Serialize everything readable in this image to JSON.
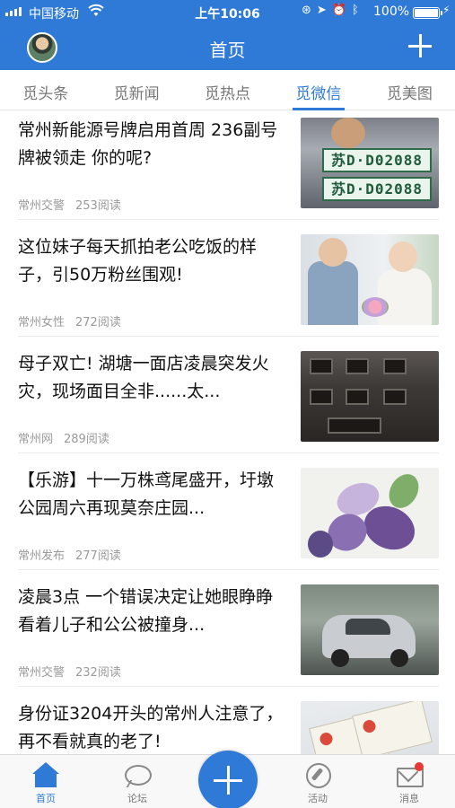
{
  "colors": {
    "brand": "#2f7ad6",
    "badge": "#e53935"
  },
  "status_bar": {
    "carrier": "中国移动",
    "time": "上午10:06",
    "battery": "100%"
  },
  "header": {
    "title": "首页",
    "avatar_icon": "user-avatar",
    "add_icon": "plus-icon"
  },
  "tabs": [
    {
      "label": "觅头条",
      "active": false
    },
    {
      "label": "觅新闻",
      "active": false
    },
    {
      "label": "觅热点",
      "active": false
    },
    {
      "label": "觅微信",
      "active": true
    },
    {
      "label": "觅美图",
      "active": false
    }
  ],
  "articles": [
    {
      "title": "常州新能源号牌启用首周 236副号牌被领走 你的呢?",
      "source": "常州交警",
      "reads": "253阅读",
      "plate_text": "苏D·D02088"
    },
    {
      "title": "这位妹子每天抓拍老公吃饭的样子，引50万粉丝围观!",
      "source": "常州女性",
      "reads": "272阅读"
    },
    {
      "title": "母子双亡! 湖塘一面店凌晨突发火灾，现场面目全非......太...",
      "source": "常州网",
      "reads": "289阅读"
    },
    {
      "title": "【乐游】十一万株鸢尾盛开，圩墩公园周六再现莫奈庄园...",
      "source": "常州发布",
      "reads": "277阅读"
    },
    {
      "title": "凌晨3点 一个错误决定让她眼睁睁看着儿子和公公被撞身...",
      "source": "常州交警",
      "reads": "232阅读"
    },
    {
      "title": "身份证3204开头的常州人注意了，再不看就真的老了!",
      "source": "",
      "reads": ""
    }
  ],
  "bottom_nav": {
    "items": [
      {
        "label": "首页",
        "icon": "home-icon",
        "active": true
      },
      {
        "label": "论坛",
        "icon": "chat-bubble-icon",
        "active": false
      },
      {
        "label": "活动",
        "icon": "compass-icon",
        "active": false
      },
      {
        "label": "消息",
        "icon": "mail-icon",
        "active": false,
        "has_badge": true
      }
    ],
    "center_icon": "plus-icon"
  }
}
